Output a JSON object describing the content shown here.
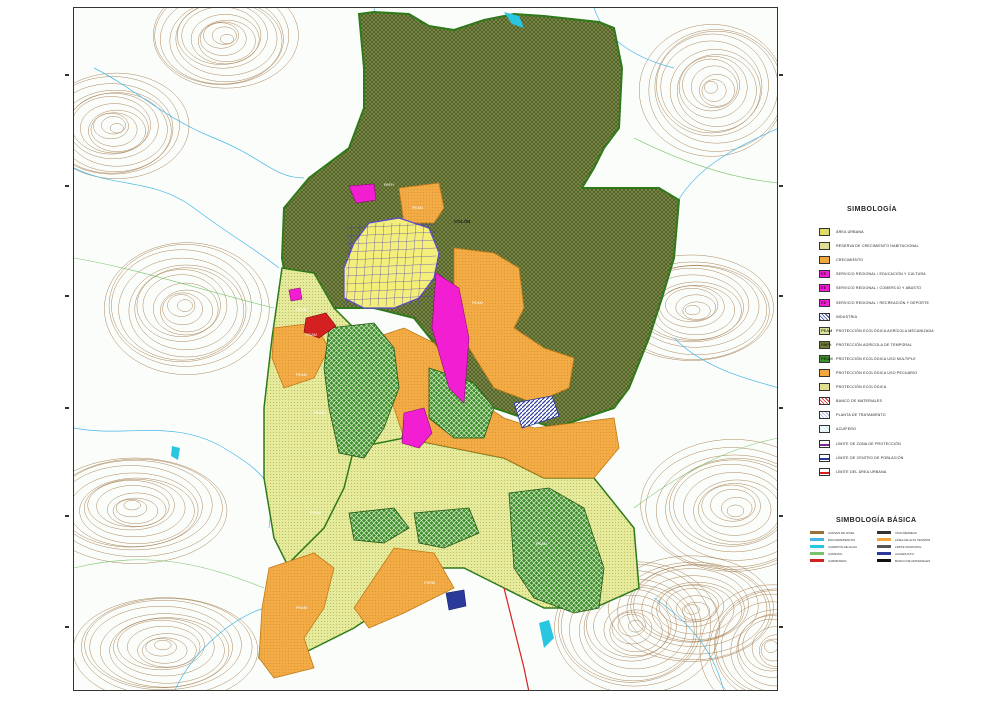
{
  "map": {
    "town_label": "COLÓN",
    "zone_codes": [
      "PEAM",
      "PAFH",
      "PEUM",
      "PEAM",
      "PSAM",
      "PEAM",
      "PEAM",
      "PEAM",
      "PSRM",
      "PEAM",
      "PHAM"
    ],
    "colors": {
      "forest": "#6f7f3a",
      "forest_hatch": "#4c5a22",
      "agriculture_light": "#dbe39a",
      "agriculture_yellow": "#eef0b6",
      "orange": "#f2a73c",
      "green_protection": "#3f8f2c",
      "magenta": "#f21fd2",
      "blue_hatch": "#2b3a9a",
      "water": "#28c6e0",
      "contours": "#9b6f3b",
      "streams": "#46b6e6",
      "roads": "#7ac36a",
      "boundary": "#2e7a1a",
      "red_road": "#d42020"
    }
  },
  "legend": {
    "title": "SIMBOLOGÍA",
    "items": [
      {
        "code": "",
        "label": "ÁREA URBANA",
        "color": "#f3ef7a",
        "pattern": "dots"
      },
      {
        "code": "",
        "label": "RESERVA DE CRECIMIENTO HABITACIONAL",
        "color": "#f5f3b0",
        "pattern": "dots"
      },
      {
        "code": "",
        "label": "CRECIMIENTO",
        "color": "#f2a73c",
        "pattern": "solid"
      },
      {
        "code": "EE",
        "label": "SERVICIO REGIONAL / EDUCACIÓN Y CULTURA",
        "color": "#f21fd2",
        "pattern": "solid"
      },
      {
        "code": "EE",
        "label": "SERVICIO REGIONAL / COMERCIO Y ABASTO",
        "color": "#f21fd2",
        "pattern": "solid"
      },
      {
        "code": "EE",
        "label": "SERVICIO REGIONAL / RECREACIÓN Y DEPORTE",
        "color": "#f21fd2",
        "pattern": "solid"
      },
      {
        "code": "",
        "label": "INDUSTRIA",
        "color": "#2b3a9a",
        "pattern": "hatch"
      },
      {
        "code": "PEAM",
        "label": "PROTECCIÓN ECOLÓGICA AGRÍCOLA MECANIZADA",
        "color": "#dbe39a",
        "pattern": "solid"
      },
      {
        "code": "PAFH",
        "label": "PROTECCIÓN AGRÍCOLA DE TEMPORAL",
        "color": "#6f7f3a",
        "pattern": "solid"
      },
      {
        "code": "PEUM",
        "label": "PROTECCIÓN ECOLÓGICA USO MÚLTIPLE",
        "color": "#3f8f2c",
        "pattern": "solid"
      },
      {
        "code": "",
        "label": "PROTECCIÓN ECOLÓGICA USO PECUARIO",
        "color": "#f2a73c",
        "pattern": "solid"
      },
      {
        "code": "",
        "label": "PROTECCIÓN ECOLÓGICA",
        "color": "#f5f3b0",
        "pattern": "dots"
      },
      {
        "code": "",
        "label": "BANCO DE MATERIALES",
        "color": "#d42020",
        "pattern": "hatch"
      },
      {
        "code": "",
        "label": "PLANTA DE TRATAMIENTO",
        "color": "#9fb4e8",
        "pattern": "hatch"
      },
      {
        "code": "",
        "label": "ACUÍFERO",
        "color": "#bfe9f2",
        "pattern": "hatch"
      },
      {
        "code": "",
        "label": "LÍMITE DE ZONA DE PROTECCIÓN",
        "color": "#ffffff",
        "pattern": "line-purple"
      },
      {
        "code": "",
        "label": "LÍMITE DE CENTRO DE POBLACIÓN",
        "color": "#ffffff",
        "pattern": "line-blue"
      },
      {
        "code": "",
        "label": "LÍMITE DEL ÁREA URBANA",
        "color": "#ffffff",
        "pattern": "line-red"
      }
    ]
  },
  "basic_legend": {
    "title": "SIMBOLOGÍA BÁSICA",
    "items": [
      {
        "label": "CURVAS DE NIVEL",
        "color": "#9b6f3b"
      },
      {
        "label": "ESCURRIMIENTOS",
        "color": "#46b6e6"
      },
      {
        "label": "CUERPOS DE AGUA",
        "color": "#28c6e0"
      },
      {
        "label": "CAMINOS",
        "color": "#7ac36a"
      },
      {
        "label": "CARRETERA",
        "color": "#d42020"
      },
      {
        "label": "VÍAS FÉRREAS",
        "color": "#333333"
      },
      {
        "label": "LÍNEA DE ALTA TENSIÓN",
        "color": "#f2a73c"
      },
      {
        "label": "LÍMITE MUNICIPAL",
        "color": "#555555"
      },
      {
        "label": "ACUEDUCTO",
        "color": "#2b3a9a"
      },
      {
        "label": "BANCO DE MATERIALES",
        "color": "#111111"
      }
    ]
  }
}
